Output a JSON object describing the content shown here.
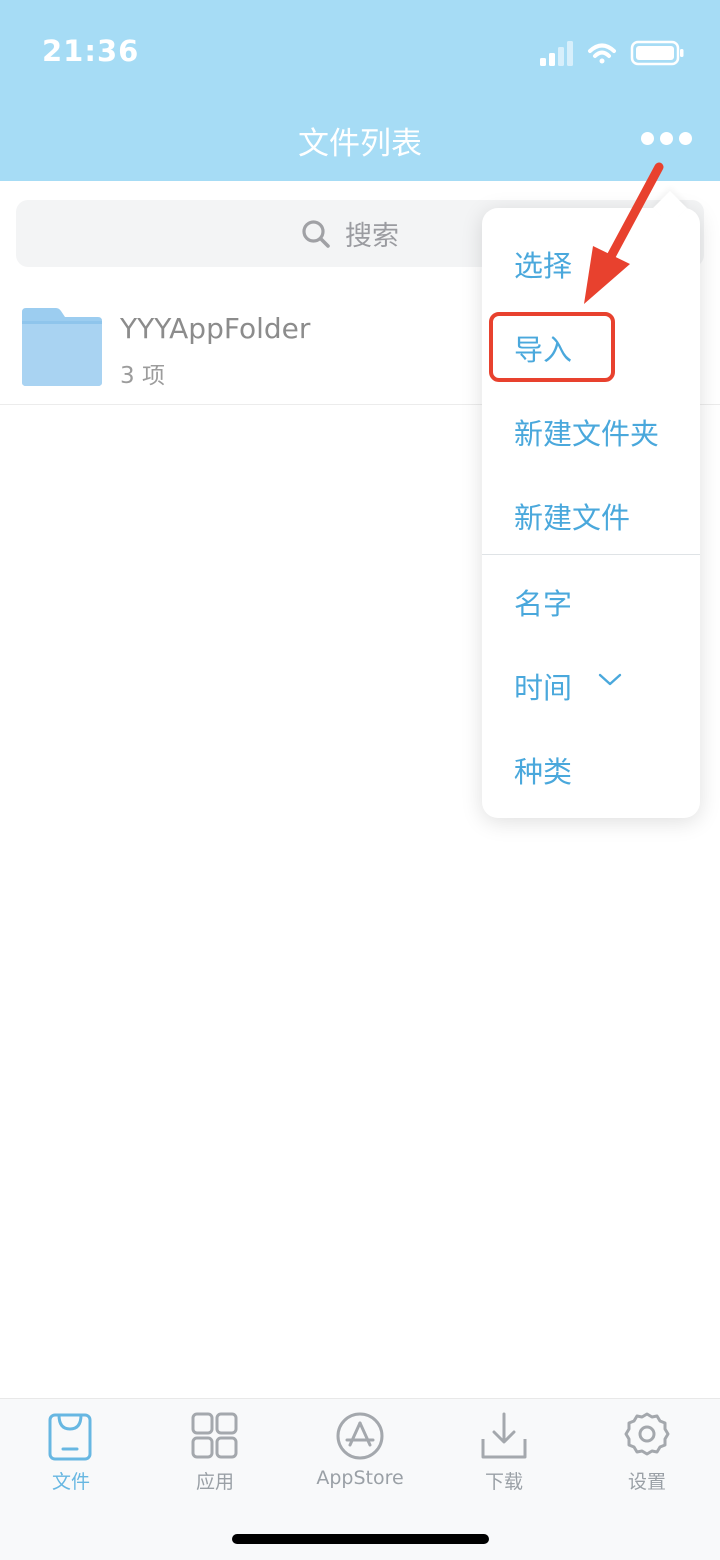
{
  "status_bar": {
    "time": "21:36"
  },
  "header": {
    "title": "文件列表"
  },
  "search": {
    "placeholder": "搜索"
  },
  "files": [
    {
      "name": "YYYAppFolder",
      "meta": "3 项"
    }
  ],
  "menu": {
    "actions": [
      "选择",
      "导入",
      "新建文件夹",
      "新建文件"
    ],
    "sort": [
      "名字",
      "时间",
      "种类"
    ]
  },
  "tabs": [
    {
      "label": "文件",
      "icon": "files-icon",
      "active": true
    },
    {
      "label": "应用",
      "icon": "apps-grid-icon",
      "active": false
    },
    {
      "label": "AppStore",
      "icon": "appstore-icon",
      "active": false
    },
    {
      "label": "下载",
      "icon": "download-icon",
      "active": false
    },
    {
      "label": "设置",
      "icon": "gear-icon",
      "active": false
    }
  ],
  "colors": {
    "header_bg": "#a6dcf5",
    "accent": "#4aa8dc",
    "annotation": "#e8412e",
    "folder": "#9ccdf0"
  }
}
